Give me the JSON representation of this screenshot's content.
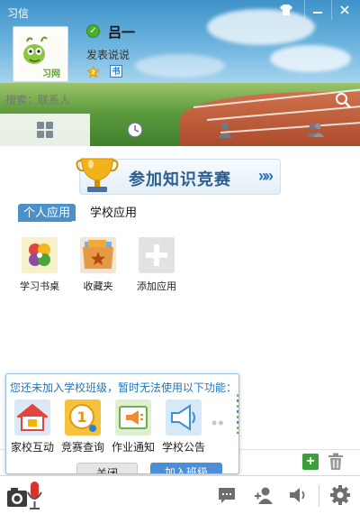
{
  "window": {
    "title": "习信"
  },
  "profile": {
    "name": "吕一",
    "mood": "发表说说",
    "avatar_text": "习网",
    "book_badge": "书"
  },
  "search": {
    "placeholder": "搜索：联系人"
  },
  "banner": {
    "text": "参加知识竞赛",
    "arrows": "»»"
  },
  "app_tabs": [
    {
      "label": "个人应用",
      "active": true
    },
    {
      "label": "学校应用",
      "active": false
    }
  ],
  "apps": [
    {
      "label": "学习书桌",
      "icon": "clover-icon"
    },
    {
      "label": "收藏夹",
      "icon": "star-folder-icon"
    },
    {
      "label": "添加应用",
      "icon": "plus-icon"
    }
  ],
  "popup": {
    "message": "您还未加入学校班级，暂时无法使用以下功能：",
    "apps": [
      {
        "label": "家校互动",
        "icon": "house-icon"
      },
      {
        "label": "竞赛查询",
        "icon": "medal-icon"
      },
      {
        "label": "作业通知",
        "icon": "megaphone-icon"
      },
      {
        "label": "学校公告",
        "icon": "speaker-icon"
      }
    ],
    "more": "••",
    "close_label": "关闭",
    "join_label": "加入班级"
  },
  "colors": {
    "accent": "#4d90c8",
    "link": "#2277bb",
    "add_green": "#3aa03a"
  }
}
